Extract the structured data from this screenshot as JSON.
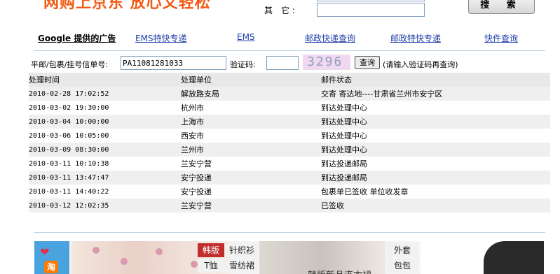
{
  "header": {
    "slogan": "网购上京东 放心又轻松",
    "other_label": "其 它:",
    "search_button": "搜 索"
  },
  "nav": {
    "google_ads": "Google 提供的广告",
    "links": [
      "EMS特快专递",
      "EMS",
      "邮政快递查询",
      "邮政特快专递",
      "快件查询"
    ]
  },
  "form": {
    "tracking_label": "平邮/包裹/挂号信单号:",
    "tracking_value": "PA11081281033",
    "captcha_label": "验证码:",
    "captcha_text": "3296",
    "query_button": "查询",
    "hint": "(请输入验证码再查询)"
  },
  "table": {
    "headers": [
      "处理时间",
      "处理单位",
      "邮件状态"
    ],
    "rows": [
      [
        "2010-02-28 17:02:52",
        "解放路支局",
        "交寄 寄达地----甘肃省兰州市安宁区"
      ],
      [
        "2010-03-02 19:30:00",
        "杭州市",
        "到达处理中心"
      ],
      [
        "2010-03-04 10:00:00",
        "上海市",
        "到达处理中心"
      ],
      [
        "2010-03-06 10:05:00",
        "西安市",
        "到达处理中心"
      ],
      [
        "2010-03-09 08:30:00",
        "兰州市",
        "到达处理中心"
      ],
      [
        "2010-03-11 10:10:38",
        "兰安宁营",
        "到达投递邮局"
      ],
      [
        "2010-03-11 13:47:47",
        "安宁投递",
        "到达投递邮局"
      ],
      [
        "2010-03-11 14:40:22",
        "安宁投递",
        "包裹单已签收 单位收发章"
      ],
      [
        "2010-03-12 12:02:35",
        "兰安宁营",
        "已签收"
      ]
    ]
  },
  "ad": {
    "logo_glyph": "淘",
    "categories_left": [
      "韩版",
      "针织衫",
      "T恤",
      "雪纺裙"
    ],
    "caption": "韩版新品连衣裙",
    "categories_right": [
      "外套",
      "包包"
    ]
  },
  "colors": {
    "slogan": "#f25a14",
    "link": "#1f3ea8",
    "hot_category": "#c12d2d"
  }
}
